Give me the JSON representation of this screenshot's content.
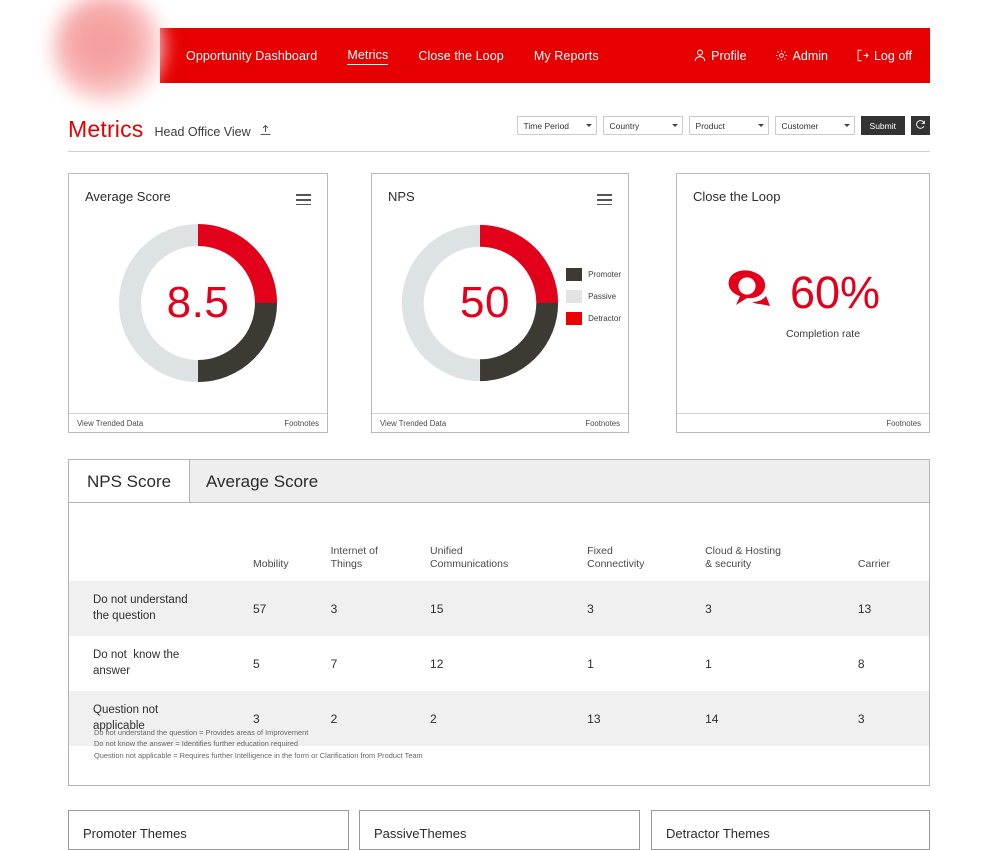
{
  "nav": {
    "links": [
      {
        "label": "Opportunity Dashboard",
        "active": false
      },
      {
        "label": "Metrics",
        "active": true
      },
      {
        "label": "Close the Loop",
        "active": false
      },
      {
        "label": "My Reports",
        "active": false
      }
    ],
    "account": [
      {
        "label": "Profile",
        "icon": "user-icon"
      },
      {
        "label": "Admin",
        "icon": "gear-icon"
      },
      {
        "label": "Log off",
        "icon": "logout-icon"
      }
    ],
    "bar_color": "#e60000"
  },
  "header": {
    "title": "Metrics",
    "view_name": "Head Office View",
    "export_icon": "upload-icon",
    "title_color": "#e60000"
  },
  "filters": {
    "selects": [
      {
        "label": "Time Period"
      },
      {
        "label": "Country"
      },
      {
        "label": "Product"
      },
      {
        "label": "Customer"
      }
    ],
    "submit_label": "Submit",
    "refresh_icon": "refresh-icon"
  },
  "cards": {
    "average": {
      "title": "Average Score",
      "value": "8.5",
      "menu_icon": "hamburger-menu-icon",
      "footer_left": "View Trended Data",
      "footer_right": "Footnotes"
    },
    "nps": {
      "title": "NPS",
      "value": "50",
      "menu_icon": "hamburger-menu-icon",
      "footer_left": "View Trended Data",
      "footer_right": "Footnotes",
      "legend": [
        {
          "label": "Promoter",
          "color": "#3c3a33"
        },
        {
          "label": "Passive",
          "color": "#e3e3e3"
        },
        {
          "label": "Detractor",
          "color": "#ec0000"
        }
      ]
    },
    "ctl": {
      "title": "Close the Loop",
      "icon": "speech-bubbles-icon",
      "value": "60%",
      "caption": "Completion rate",
      "footer_right": "Footnotes"
    }
  },
  "chart_data": [
    {
      "type": "pie",
      "title": "Average Score",
      "center_label": "8.5",
      "labels": [
        "Detractor",
        "Promoter",
        "Passive"
      ],
      "values": [
        25,
        25,
        50
      ],
      "colors": [
        "#e2001a",
        "#3c3a33",
        "#dde3e5"
      ],
      "start_angle": 0,
      "donut": true
    },
    {
      "type": "pie",
      "title": "NPS",
      "center_label": "50",
      "labels": [
        "Detractor",
        "Promoter",
        "Passive"
      ],
      "values": [
        25,
        25,
        50
      ],
      "colors": [
        "#e2001a",
        "#3c3a33",
        "#dde3e5"
      ],
      "start_angle": 0,
      "donut": true,
      "legend_position": "right"
    },
    {
      "type": "table",
      "title": "NPS Score",
      "categories": [
        "Mobility",
        "Internet of Things",
        "Unified Communications",
        "Fixed Connectivity",
        "Cloud & Hosting & security",
        "Carrier"
      ],
      "series": [
        {
          "name": "Do not understand the question",
          "values": [
            57,
            3,
            15,
            3,
            3,
            13
          ]
        },
        {
          "name": "Do not  know the answer",
          "values": [
            5,
            7,
            12,
            1,
            1,
            8
          ]
        },
        {
          "name": "Question not applicable",
          "values": [
            3,
            2,
            2,
            13,
            14,
            3
          ]
        }
      ]
    }
  ],
  "panel": {
    "tabs": [
      {
        "label": "NPS Score",
        "active": true
      },
      {
        "label": "Average Score",
        "active": false
      }
    ],
    "table": {
      "columns": [
        "",
        "Mobility",
        "Internet of\nThings",
        "Unified\nCommunications",
        "Fixed\nConnectivity",
        "Cloud & Hosting\n& security",
        "Carrier"
      ],
      "rows": [
        {
          "label": "Do not understand\nthe question",
          "cells": [
            "57",
            "3",
            "15",
            "3",
            "3",
            "13"
          ],
          "shaded": true
        },
        {
          "label": "Do not  know the\nanswer",
          "cells": [
            "5",
            "7",
            "12",
            "1",
            "1",
            "8"
          ],
          "shaded": false
        },
        {
          "label": "Question not\napplicable",
          "cells": [
            "3",
            "2",
            "2",
            "13",
            "14",
            "3"
          ],
          "shaded": true
        }
      ]
    },
    "footnotes": [
      "Do not understand the question = Provides areas of Improvement",
      "Do not know the answer = Identifies further education required",
      "Question not applicable = Requires further Intelligence in the form or Clarification from Product Team"
    ]
  },
  "themes": [
    {
      "title": "Promoter Themes"
    },
    {
      "title": "PassiveThemes"
    },
    {
      "title": "Detractor Themes"
    }
  ]
}
